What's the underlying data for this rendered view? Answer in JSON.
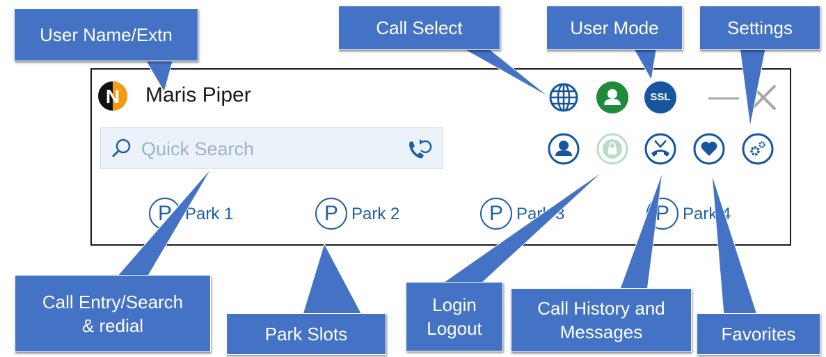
{
  "app": {
    "user_name": "Maris Piper",
    "logo_letter": "N",
    "search_placeholder": "Quick Search",
    "ssl_label": "SSL",
    "park_slots": [
      {
        "letter": "P",
        "label": "Park 1"
      },
      {
        "letter": "P",
        "label": "Park 2"
      },
      {
        "letter": "P",
        "label": "Park 3"
      },
      {
        "letter": "P",
        "label": "Park 4"
      }
    ],
    "icons": {
      "call_select": "globe-icon",
      "user_mode": "user-icon",
      "security": "ssl-icon",
      "presence": "contact-icon",
      "login": "lock-icon",
      "call_history": "call-history-icon",
      "favorites": "heart-icon",
      "settings": "gears-icon",
      "search": "search-icon",
      "redial": "redial-icon"
    }
  },
  "callouts": {
    "user_name": "User Name/Extn",
    "call_select": "Call Select",
    "user_mode": "User Mode",
    "settings": "Settings",
    "call_entry": "Call Entry/Search\n& redial",
    "park_slots": "Park Slots",
    "login": "Login\nLogout",
    "call_history": "Call History and\nMessages",
    "favorites": "Favorites"
  },
  "colors": {
    "brand_blue": "#1d5fa5",
    "dark_blue": "#16569e",
    "green": "#1f8b3a",
    "callout_blue": "#4472c4",
    "logo_orange": "#f39c12",
    "search_bg": "#ebf2f9",
    "placeholder": "#9db3c7"
  }
}
